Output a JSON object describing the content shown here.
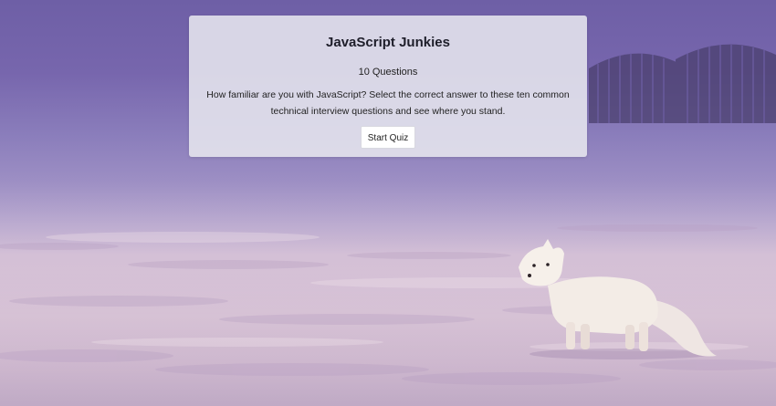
{
  "quiz": {
    "title": "JavaScript Junkies",
    "question_count": "10 Questions",
    "description": "How familiar are you with JavaScript? Select the correct answer to these ten common technical interview questions and see where you stand.",
    "start_label": "Start Quiz"
  },
  "background": {
    "subject": "arctic fox standing on snow",
    "colors": {
      "sky": "#6e5fa6",
      "snow": "#d6c3d8",
      "card": "#e6e6ee"
    }
  }
}
